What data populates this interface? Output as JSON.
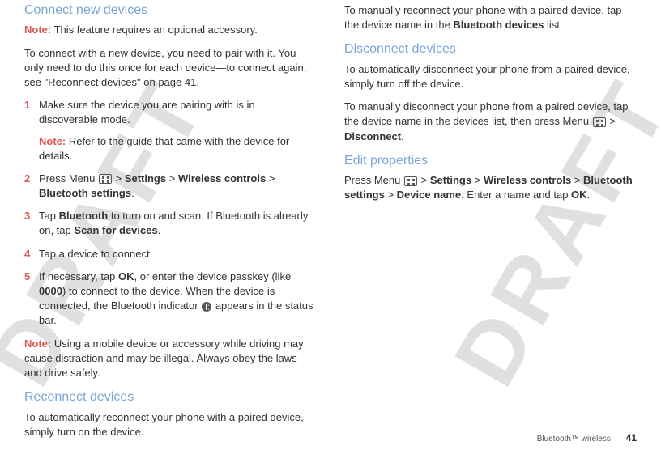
{
  "watermark": "DRAFT",
  "col1": {
    "h1": "Connect new devices",
    "note1_label": "Note:",
    "note1_text": " This feature requires an optional accessory.",
    "p1": "To connect with a new device, you need to pair with it. You only need to do this once for each device—to connect again, see \"Reconnect devices\" on page 41.",
    "steps": [
      {
        "num": "1",
        "text": "Make sure the device you are pairing with is in discoverable mode.",
        "note_label": "Note:",
        "note_text": " Refer to the guide that came with the device for details."
      },
      {
        "num": "2",
        "pre": "Press Menu ",
        "gt1": " > ",
        "b1": "Settings",
        "gt2": " > ",
        "b2": "Wireless controls",
        "gt3": " > ",
        "b3": "Bluetooth settings",
        "end": "."
      },
      {
        "num": "3",
        "pre": "Tap ",
        "b1": "Bluetooth",
        "mid": " to turn on and scan. If Bluetooth is already on, tap ",
        "b2": "Scan for devices",
        "end": "."
      },
      {
        "num": "4",
        "text": "Tap a device to connect."
      },
      {
        "num": "5",
        "pre": "If necessary, tap ",
        "b1": "OK",
        "mid1": ", or enter the device passkey (like ",
        "b2": "0000",
        "mid2": ") to connect to the device. When the device is connected, the Bluetooth indicator ",
        "end": " appears in the status bar."
      }
    ],
    "note2_label": "Note:",
    "note2_text": " Using a mobile device or accessory while driving may cause distraction and may be illegal. Always obey the laws and drive safely.",
    "h2": "Reconnect devices",
    "p2": "To automatically reconnect your phone with a paired device, simply turn on the device."
  },
  "col2": {
    "p1a": "To manually reconnect your phone with a paired device, tap the device name in the ",
    "p1b": "Bluetooth devices",
    "p1c": " list.",
    "h1": "Disconnect devices",
    "p2": "To automatically disconnect your phone from a paired device, simply turn off the device.",
    "p3a": "To manually disconnect your phone from a paired device, tap the device name in the devices list, then press Menu ",
    "p3gt": " > ",
    "p3b": "Disconnect",
    "p3end": ".",
    "h2": "Edit properties",
    "p4a": "Press Menu ",
    "p4gt1": " > ",
    "p4b1": "Settings",
    "p4gt2": " > ",
    "p4b2": "Wireless controls",
    "p4gt3": " > ",
    "p4b3": "Bluetooth settings",
    "p4gt4": " > ",
    "p4b4": "Device name",
    "p4mid": ". Enter a name and tap ",
    "p4b5": "OK",
    "p4end": "."
  },
  "footer": {
    "section": "Bluetooth™ wireless",
    "page": "41"
  }
}
